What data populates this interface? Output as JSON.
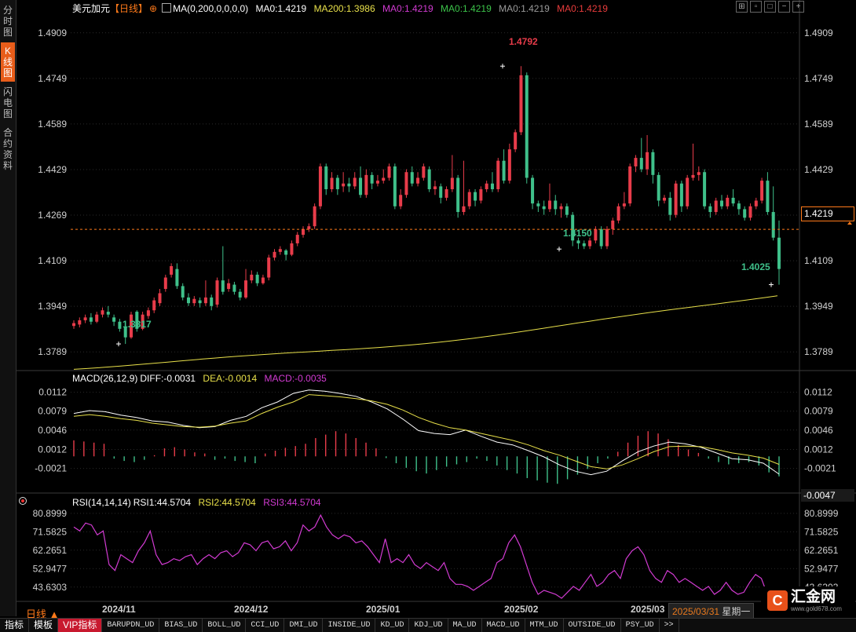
{
  "sidebar": {
    "tabs": [
      {
        "label": "分时图",
        "active": false
      },
      {
        "label": "K线图",
        "active": true
      },
      {
        "label": "闪电图",
        "active": false
      },
      {
        "label": "合约资料",
        "active": false
      }
    ]
  },
  "header": {
    "symbol": "美元加元",
    "period": "【日线】",
    "period_icon": "plus-circle-icon",
    "ma_label": "MA(0,200,0,0,0,0)",
    "ma_values": [
      {
        "text": "MA0:1.4219",
        "color": "#ffffff"
      },
      {
        "text": "MA200:1.3986",
        "color": "#e8e04a"
      },
      {
        "text": "MA0:1.4219",
        "color": "#d23bd2"
      },
      {
        "text": "MA0:1.4219",
        "color": "#3cc44a"
      },
      {
        "text": "MA0:1.4219",
        "color": "#9a9a9a"
      },
      {
        "text": "MA0:1.4219",
        "color": "#e83c3c"
      }
    ],
    "window_icons": [
      "fit-icon",
      "restore-icon",
      "maximize-icon",
      "zoom-out-icon",
      "zoom-in-icon"
    ]
  },
  "macd_legend": {
    "label": "MACD(26,12,9)",
    "diff": "DIFF:-0.0031",
    "dea": "DEA:-0.0014",
    "macd": "MACD:-0.0035"
  },
  "rsi_legend": {
    "label": "RSI(14,14,14)",
    "rsi1": "RSI1:44.5704",
    "rsi2": "RSI2:44.5704",
    "rsi3": "RSI3:44.5704"
  },
  "current_price": "1.4219",
  "macd_current": "-0.0047",
  "period_label": "日线 ▲",
  "date_box": {
    "date": "2025/03/31",
    "weekday": "星期一"
  },
  "logo": {
    "text": "汇金网",
    "sub": "www.gold678.com"
  },
  "bottom_tabs": [
    "指标",
    "模板",
    "VIP指标",
    "BARUPDN_UD",
    "BIAS_UD",
    "BOLL_UD",
    "CCI_UD",
    "DMI_UD",
    "INSIDE_UD",
    "KD_UD",
    "KDJ_UD",
    "MA_UD",
    "MACD_UD",
    "MTM_UD",
    "OUTSIDE_UD",
    "PSY_UD",
    ">>"
  ],
  "bottom_active": "VIP指标",
  "colors": {
    "up": "#e83c4a",
    "down": "#3fc08a",
    "ma200": "#e8e04a",
    "diff": "#ffffff",
    "dea": "#e8e04a",
    "rsi": "#d23bd2",
    "grid": "#2a2a2a",
    "axis_text": "#d0d0d0"
  },
  "chart_data": [
    {
      "type": "candlestick",
      "title": "美元加元 日线",
      "ylim": [
        1.3729,
        1.4969
      ],
      "y_ticks": [
        1.4909,
        1.4749,
        1.4589,
        1.4429,
        1.4269,
        1.4109,
        1.3949,
        1.3789
      ],
      "x_ticks": [
        "2024/11",
        "2024/12",
        "2025/01",
        "2025/02",
        "2025/03"
      ],
      "annotations": [
        {
          "text": "1.4792",
          "value": 1.4792,
          "color": "#e83c4a"
        },
        {
          "text": "1.4150",
          "value": 1.415,
          "color": "#3fc08a"
        },
        {
          "text": "1.4025",
          "value": 1.4025,
          "color": "#3fc08a"
        },
        {
          "text": "1.3817",
          "value": 1.3817,
          "color": "#3fc08a"
        }
      ],
      "current_line": 1.4219,
      "ma200": {
        "start": 1.3728,
        "end": 1.3986
      },
      "candles": [
        [
          1.388,
          1.389,
          1.387,
          1.39
        ],
        [
          1.3885,
          1.39,
          1.3875,
          1.391
        ],
        [
          1.39,
          1.391,
          1.389,
          1.392
        ],
        [
          1.391,
          1.3895,
          1.3885,
          1.3925
        ],
        [
          1.3895,
          1.392,
          1.389,
          1.393
        ],
        [
          1.392,
          1.3935,
          1.391,
          1.3945
        ],
        [
          1.393,
          1.392,
          1.391,
          1.395
        ],
        [
          1.391,
          1.3895,
          1.388,
          1.392
        ],
        [
          1.3895,
          1.387,
          1.386,
          1.3905
        ],
        [
          1.3875,
          1.384,
          1.3817,
          1.389
        ],
        [
          1.384,
          1.392,
          1.3835,
          1.393
        ],
        [
          1.393,
          1.387,
          1.386,
          1.3935
        ],
        [
          1.387,
          1.392,
          1.3865,
          1.393
        ],
        [
          1.3915,
          1.3935,
          1.3905,
          1.3945
        ],
        [
          1.3935,
          1.397,
          1.3925,
          1.398
        ],
        [
          1.396,
          1.3995,
          1.395,
          1.401
        ],
        [
          1.401,
          1.405,
          1.4,
          1.406
        ],
        [
          1.406,
          1.409,
          1.405,
          1.41
        ],
        [
          1.408,
          1.402,
          1.401,
          1.41
        ],
        [
          1.402,
          1.398,
          1.397,
          1.403
        ],
        [
          1.398,
          1.396,
          1.395,
          1.3995
        ],
        [
          1.396,
          1.3975,
          1.395,
          1.3985
        ],
        [
          1.397,
          1.396,
          1.3945,
          1.398
        ],
        [
          1.396,
          1.398,
          1.395,
          1.404
        ],
        [
          1.398,
          1.395,
          1.3935,
          1.399
        ],
        [
          1.3955,
          1.404,
          1.3945,
          1.405
        ],
        [
          1.404,
          1.4,
          1.399,
          1.416
        ],
        [
          1.401,
          1.403,
          1.4,
          1.4045
        ],
        [
          1.4025,
          1.4,
          1.399,
          1.4035
        ],
        [
          1.4,
          1.398,
          1.397,
          1.401
        ],
        [
          1.398,
          1.404,
          1.3975,
          1.408
        ],
        [
          1.404,
          1.406,
          1.403,
          1.4075
        ],
        [
          1.406,
          1.403,
          1.402,
          1.407
        ],
        [
          1.403,
          1.405,
          1.4025,
          1.406
        ],
        [
          1.405,
          1.412,
          1.404,
          1.413
        ],
        [
          1.412,
          1.414,
          1.411,
          1.415
        ],
        [
          1.414,
          1.415,
          1.413,
          1.416
        ],
        [
          1.4145,
          1.413,
          1.411,
          1.415
        ],
        [
          1.413,
          1.417,
          1.4125,
          1.418
        ],
        [
          1.417,
          1.42,
          1.416,
          1.421
        ],
        [
          1.42,
          1.422,
          1.419,
          1.423
        ],
        [
          1.422,
          1.423,
          1.421,
          1.424
        ],
        [
          1.423,
          1.43,
          1.422,
          1.431
        ],
        [
          1.43,
          1.444,
          1.429,
          1.445
        ],
        [
          1.444,
          1.436,
          1.434,
          1.445
        ],
        [
          1.436,
          1.44,
          1.435,
          1.442
        ],
        [
          1.44,
          1.436,
          1.434,
          1.441
        ],
        [
          1.437,
          1.438,
          1.435,
          1.442
        ],
        [
          1.438,
          1.437,
          1.435,
          1.44
        ],
        [
          1.437,
          1.44,
          1.436,
          1.442
        ],
        [
          1.44,
          1.434,
          1.433,
          1.444
        ],
        [
          1.434,
          1.441,
          1.433,
          1.443
        ],
        [
          1.441,
          1.438,
          1.436,
          1.442
        ],
        [
          1.438,
          1.439,
          1.437,
          1.441
        ],
        [
          1.439,
          1.44,
          1.438,
          1.443
        ],
        [
          1.44,
          1.444,
          1.439,
          1.445
        ],
        [
          1.444,
          1.43,
          1.429,
          1.445
        ],
        [
          1.43,
          1.434,
          1.429,
          1.436
        ],
        [
          1.434,
          1.442,
          1.433,
          1.443
        ],
        [
          1.442,
          1.438,
          1.437,
          1.444
        ],
        [
          1.438,
          1.44,
          1.437,
          1.442
        ],
        [
          1.44,
          1.444,
          1.439,
          1.445
        ],
        [
          1.443,
          1.436,
          1.435,
          1.444
        ],
        [
          1.436,
          1.437,
          1.434,
          1.439
        ],
        [
          1.437,
          1.433,
          1.431,
          1.438
        ],
        [
          1.433,
          1.436,
          1.432,
          1.437
        ],
        [
          1.436,
          1.44,
          1.435,
          1.448
        ],
        [
          1.44,
          1.428,
          1.426,
          1.441
        ],
        [
          1.428,
          1.43,
          1.427,
          1.446
        ],
        [
          1.43,
          1.435,
          1.429,
          1.436
        ],
        [
          1.435,
          1.432,
          1.43,
          1.436
        ],
        [
          1.432,
          1.436,
          1.431,
          1.437
        ],
        [
          1.436,
          1.438,
          1.435,
          1.439
        ],
        [
          1.438,
          1.436,
          1.435,
          1.442
        ],
        [
          1.436,
          1.446,
          1.435,
          1.447
        ],
        [
          1.446,
          1.439,
          1.438,
          1.45
        ],
        [
          1.439,
          1.45,
          1.438,
          1.452
        ],
        [
          1.45,
          1.456,
          1.449,
          1.457
        ],
        [
          1.456,
          1.476,
          1.455,
          1.4792
        ],
        [
          1.476,
          1.44,
          1.438,
          1.477
        ],
        [
          1.44,
          1.431,
          1.429,
          1.441
        ],
        [
          1.431,
          1.43,
          1.428,
          1.432
        ],
        [
          1.43,
          1.429,
          1.427,
          1.432
        ],
        [
          1.429,
          1.432,
          1.428,
          1.438
        ],
        [
          1.432,
          1.429,
          1.427,
          1.434
        ],
        [
          1.429,
          1.43,
          1.426,
          1.431
        ],
        [
          1.43,
          1.427,
          1.426,
          1.431
        ],
        [
          1.427,
          1.418,
          1.416,
          1.428
        ],
        [
          1.418,
          1.417,
          1.415,
          1.419
        ],
        [
          1.417,
          1.416,
          1.415,
          1.418
        ],
        [
          1.416,
          1.418,
          1.415,
          1.419
        ],
        [
          1.418,
          1.422,
          1.417,
          1.423
        ],
        [
          1.422,
          1.416,
          1.415,
          1.423
        ],
        [
          1.416,
          1.422,
          1.415,
          1.423
        ],
        [
          1.422,
          1.425,
          1.42,
          1.426
        ],
        [
          1.425,
          1.43,
          1.424,
          1.431
        ],
        [
          1.43,
          1.431,
          1.429,
          1.435
        ],
        [
          1.431,
          1.444,
          1.43,
          1.445
        ],
        [
          1.444,
          1.447,
          1.442,
          1.448
        ],
        [
          1.447,
          1.443,
          1.442,
          1.454
        ],
        [
          1.443,
          1.449,
          1.441,
          1.455
        ],
        [
          1.449,
          1.441,
          1.438,
          1.45
        ],
        [
          1.441,
          1.432,
          1.43,
          1.442
        ],
        [
          1.432,
          1.433,
          1.431,
          1.434
        ],
        [
          1.433,
          1.427,
          1.425,
          1.435
        ],
        [
          1.427,
          1.438,
          1.426,
          1.439
        ],
        [
          1.438,
          1.43,
          1.428,
          1.439
        ],
        [
          1.43,
          1.44,
          1.429,
          1.441
        ],
        [
          1.44,
          1.441,
          1.439,
          1.452
        ],
        [
          1.441,
          1.442,
          1.439,
          1.444
        ],
        [
          1.442,
          1.43,
          1.429,
          1.443
        ],
        [
          1.43,
          1.428,
          1.426,
          1.431
        ],
        [
          1.428,
          1.432,
          1.427,
          1.433
        ],
        [
          1.432,
          1.43,
          1.429,
          1.434
        ],
        [
          1.43,
          1.433,
          1.429,
          1.434
        ],
        [
          1.433,
          1.431,
          1.43,
          1.436
        ],
        [
          1.431,
          1.429,
          1.427,
          1.432
        ],
        [
          1.429,
          1.426,
          1.425,
          1.43
        ],
        [
          1.426,
          1.43,
          1.425,
          1.431
        ],
        [
          1.43,
          1.432,
          1.429,
          1.433
        ],
        [
          1.432,
          1.439,
          1.431,
          1.44
        ],
        [
          1.439,
          1.428,
          1.427,
          1.442
        ],
        [
          1.428,
          1.419,
          1.418,
          1.437
        ],
        [
          1.419,
          1.408,
          1.4025,
          1.425
        ]
      ]
    },
    {
      "type": "macd",
      "ylim": [
        -0.006,
        0.0128
      ],
      "y_ticks": [
        0.0112,
        0.0079,
        0.0046,
        0.0012,
        -0.0021
      ],
      "series": [
        {
          "name": "DIFF",
          "values": [
            0.0075,
            0.008,
            0.0078,
            0.0072,
            0.0068,
            0.0062,
            0.006,
            0.0054,
            0.005,
            0.0052,
            0.0063,
            0.007,
            0.0085,
            0.0095,
            0.011,
            0.0116,
            0.0114,
            0.011,
            0.0105,
            0.0095,
            0.0083,
            0.0065,
            0.0045,
            0.004,
            0.0038,
            0.0046,
            0.0035,
            0.0025,
            0.002,
            0.001,
            -0.0001,
            -0.0015,
            -0.0026,
            -0.0032,
            -0.0026,
            -0.0008,
            0.0008,
            0.0018,
            0.0025,
            0.0022,
            0.0016,
            0.0006,
            -0.0004,
            -0.0006,
            -0.0012,
            -0.0031
          ]
        },
        {
          "name": "DEA",
          "values": [
            0.007,
            0.0073,
            0.007,
            0.0066,
            0.0063,
            0.0058,
            0.0055,
            0.0052,
            0.0051,
            0.0053,
            0.0058,
            0.0062,
            0.0075,
            0.0086,
            0.0095,
            0.0108,
            0.0106,
            0.0104,
            0.0101,
            0.0097,
            0.0091,
            0.0081,
            0.0068,
            0.0058,
            0.005,
            0.0046,
            0.004,
            0.0034,
            0.0028,
            0.002,
            0.001,
            0.0002,
            -0.0008,
            -0.0018,
            -0.0022,
            -0.0015,
            -0.0004,
            0.0008,
            0.0017,
            0.0018,
            0.0017,
            0.0012,
            0.0006,
            0.0002,
            -0.0003,
            -0.0014
          ]
        },
        {
          "name": "MACD",
          "values": [
            0.0028,
            0.0026,
            0.0024,
            0.0022,
            -0.0004,
            -0.0008,
            -0.001,
            -0.0006,
            0.0002,
            0.0014,
            0.0016,
            0.0012,
            0.0007,
            0.0005,
            -0.0006,
            -0.0004,
            -0.0008,
            -0.001,
            -0.0012,
            0.0005,
            0.001,
            0.0015,
            0.0018,
            0.0022,
            0.0032,
            0.0038,
            0.0044,
            0.004,
            0.0032,
            0.0024,
            0.0014,
            -0.0003,
            -0.0012,
            -0.002,
            -0.0026,
            -0.003,
            -0.0024,
            -0.0018,
            -0.0014,
            -0.001,
            -0.0004,
            -0.0008,
            -0.0016,
            -0.0024,
            -0.003,
            -0.0038,
            -0.0042,
            -0.0046,
            -0.0048,
            -0.004,
            -0.0032,
            -0.0022,
            -0.0012,
            -0.0004,
            0.0008,
            0.0024,
            0.0036,
            0.0044,
            0.004,
            0.003,
            0.002,
            0.0012,
            0.0006,
            -0.0004,
            -0.001,
            -0.0014,
            -0.0012,
            -0.001,
            -0.0016,
            -0.0028,
            -0.0035
          ]
        }
      ]
    },
    {
      "type": "line",
      "ylim": [
        38.0,
        84.0
      ],
      "y_ticks": [
        80.8999,
        71.5825,
        62.2651,
        52.9477,
        43.6303
      ],
      "series": [
        {
          "name": "RSI",
          "values": [
            74,
            72,
            76,
            75,
            70,
            72,
            55,
            52,
            60,
            58,
            56,
            62,
            66,
            72,
            60,
            55,
            56,
            58,
            57,
            59,
            60,
            55,
            58,
            60,
            58,
            61,
            62,
            59,
            61,
            66,
            65,
            62,
            66,
            67,
            63,
            64,
            67,
            62,
            66,
            75,
            72,
            74,
            80,
            74,
            70,
            68,
            70,
            69,
            66,
            67,
            64,
            60,
            56,
            68,
            56,
            58,
            56,
            60,
            55,
            53,
            56,
            54,
            52,
            56,
            48,
            45,
            45,
            44,
            42,
            44,
            46,
            48,
            56,
            58,
            66,
            70,
            64,
            55,
            46,
            40,
            42,
            41,
            40,
            38,
            41,
            44,
            42,
            46,
            50,
            44,
            46,
            50,
            52,
            48,
            58,
            62,
            64,
            60,
            52,
            48,
            46,
            52,
            50,
            46,
            48,
            46,
            44,
            42,
            44,
            40,
            42,
            46,
            42,
            40,
            41,
            46,
            50,
            48,
            40,
            36,
            40
          ]
        }
      ]
    }
  ]
}
